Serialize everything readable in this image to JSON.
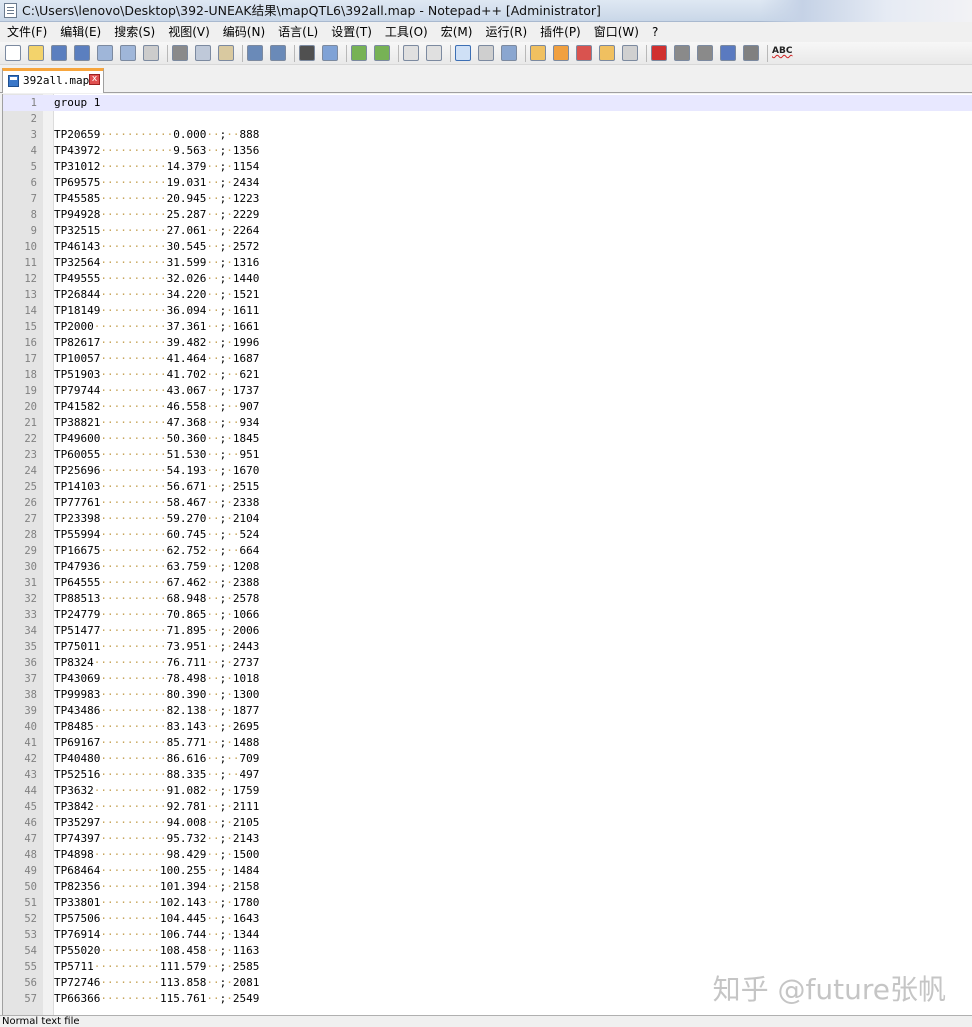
{
  "window": {
    "title": "C:\\Users\\lenovo\\Desktop\\392-UNEAK结果\\mapQTL6\\392all.map - Notepad++ [Administrator]"
  },
  "menu": [
    {
      "label": "文件(F)"
    },
    {
      "label": "编辑(E)"
    },
    {
      "label": "搜索(S)"
    },
    {
      "label": "视图(V)"
    },
    {
      "label": "编码(N)"
    },
    {
      "label": "语言(L)"
    },
    {
      "label": "设置(T)"
    },
    {
      "label": "工具(O)"
    },
    {
      "label": "宏(M)"
    },
    {
      "label": "运行(R)"
    },
    {
      "label": "插件(P)"
    },
    {
      "label": "窗口(W)"
    },
    {
      "label": "?"
    }
  ],
  "toolbar": {
    "spellcheck_label": "ABC",
    "icons": [
      "new-file-icon",
      "open-file-icon",
      "save-icon",
      "save-all-icon",
      "close-icon",
      "close-all-icon",
      "print-icon",
      "cut-icon",
      "copy-icon",
      "paste-icon",
      "undo-icon",
      "redo-icon",
      "find-icon",
      "replace-icon",
      "zoom-in-icon",
      "zoom-out-icon",
      "sync-vertical-icon",
      "sync-horizontal-icon",
      "word-wrap-icon",
      "show-all-characters-icon",
      "indent-guide-icon",
      "user-defined-language-icon",
      "document-map-icon",
      "function-list-icon",
      "folder-as-workspace-icon",
      "monitoring-icon",
      "record-macro-icon",
      "stop-record-icon",
      "play-macro-icon",
      "run-macro-multiple-icon",
      "save-macro-icon",
      "spellcheck-icon"
    ]
  },
  "tab": {
    "label": "392all.map",
    "close": "x"
  },
  "editor": {
    "first_line": "group 1",
    "rows": [
      {
        "name": "TP20659",
        "pos": "0.000",
        "id": "888"
      },
      {
        "name": "TP43972",
        "pos": "9.563",
        "id": "1356"
      },
      {
        "name": "TP31012",
        "pos": "14.379",
        "id": "1154"
      },
      {
        "name": "TP69575",
        "pos": "19.031",
        "id": "2434"
      },
      {
        "name": "TP45585",
        "pos": "20.945",
        "id": "1223"
      },
      {
        "name": "TP94928",
        "pos": "25.287",
        "id": "2229"
      },
      {
        "name": "TP32515",
        "pos": "27.061",
        "id": "2264"
      },
      {
        "name": "TP46143",
        "pos": "30.545",
        "id": "2572"
      },
      {
        "name": "TP32564",
        "pos": "31.599",
        "id": "1316"
      },
      {
        "name": "TP49555",
        "pos": "32.026",
        "id": "1440"
      },
      {
        "name": "TP26844",
        "pos": "34.220",
        "id": "1521"
      },
      {
        "name": "TP18149",
        "pos": "36.094",
        "id": "1611"
      },
      {
        "name": "TP2000",
        "pos": "37.361",
        "id": "1661"
      },
      {
        "name": "TP82617",
        "pos": "39.482",
        "id": "1996"
      },
      {
        "name": "TP10057",
        "pos": "41.464",
        "id": "1687"
      },
      {
        "name": "TP51903",
        "pos": "41.702",
        "id": "621"
      },
      {
        "name": "TP79744",
        "pos": "43.067",
        "id": "1737"
      },
      {
        "name": "TP41582",
        "pos": "46.558",
        "id": "907"
      },
      {
        "name": "TP38821",
        "pos": "47.368",
        "id": "934"
      },
      {
        "name": "TP49600",
        "pos": "50.360",
        "id": "1845"
      },
      {
        "name": "TP60055",
        "pos": "51.530",
        "id": "951"
      },
      {
        "name": "TP25696",
        "pos": "54.193",
        "id": "1670"
      },
      {
        "name": "TP14103",
        "pos": "56.671",
        "id": "2515"
      },
      {
        "name": "TP77761",
        "pos": "58.467",
        "id": "2338"
      },
      {
        "name": "TP23398",
        "pos": "59.270",
        "id": "2104"
      },
      {
        "name": "TP55994",
        "pos": "60.745",
        "id": "524"
      },
      {
        "name": "TP16675",
        "pos": "62.752",
        "id": "664"
      },
      {
        "name": "TP47936",
        "pos": "63.759",
        "id": "1208"
      },
      {
        "name": "TP64555",
        "pos": "67.462",
        "id": "2388"
      },
      {
        "name": "TP88513",
        "pos": "68.948",
        "id": "2578"
      },
      {
        "name": "TP24779",
        "pos": "70.865",
        "id": "1066"
      },
      {
        "name": "TP51477",
        "pos": "71.895",
        "id": "2006"
      },
      {
        "name": "TP75011",
        "pos": "73.951",
        "id": "2443"
      },
      {
        "name": "TP8324",
        "pos": "76.711",
        "id": "2737"
      },
      {
        "name": "TP43069",
        "pos": "78.498",
        "id": "1018"
      },
      {
        "name": "TP99983",
        "pos": "80.390",
        "id": "1300"
      },
      {
        "name": "TP43486",
        "pos": "82.138",
        "id": "1877"
      },
      {
        "name": "TP8485",
        "pos": "83.143",
        "id": "2695"
      },
      {
        "name": "TP69167",
        "pos": "85.771",
        "id": "1488"
      },
      {
        "name": "TP40480",
        "pos": "86.616",
        "id": "709"
      },
      {
        "name": "TP52516",
        "pos": "88.335",
        "id": "497"
      },
      {
        "name": "TP3632",
        "pos": "91.082",
        "id": "1759"
      },
      {
        "name": "TP3842",
        "pos": "92.781",
        "id": "2111"
      },
      {
        "name": "TP35297",
        "pos": "94.008",
        "id": "2105"
      },
      {
        "name": "TP74397",
        "pos": "95.732",
        "id": "2143"
      },
      {
        "name": "TP4898",
        "pos": "98.429",
        "id": "1500"
      },
      {
        "name": "TP68464",
        "pos": "100.255",
        "id": "1484"
      },
      {
        "name": "TP82356",
        "pos": "101.394",
        "id": "2158"
      },
      {
        "name": "TP33801",
        "pos": "102.143",
        "id": "1780"
      },
      {
        "name": "TP57506",
        "pos": "104.445",
        "id": "1643"
      },
      {
        "name": "TP76914",
        "pos": "106.744",
        "id": "1344"
      },
      {
        "name": "TP55020",
        "pos": "108.458",
        "id": "1163"
      },
      {
        "name": "TP5711",
        "pos": "111.579",
        "id": "2585"
      },
      {
        "name": "TP72746",
        "pos": "113.858",
        "id": "2081"
      },
      {
        "name": "TP66366",
        "pos": "115.761",
        "id": "2549"
      }
    ]
  },
  "statusbar": {
    "text": "Normal text file"
  },
  "watermark": {
    "text": "知乎 @future张帆"
  }
}
